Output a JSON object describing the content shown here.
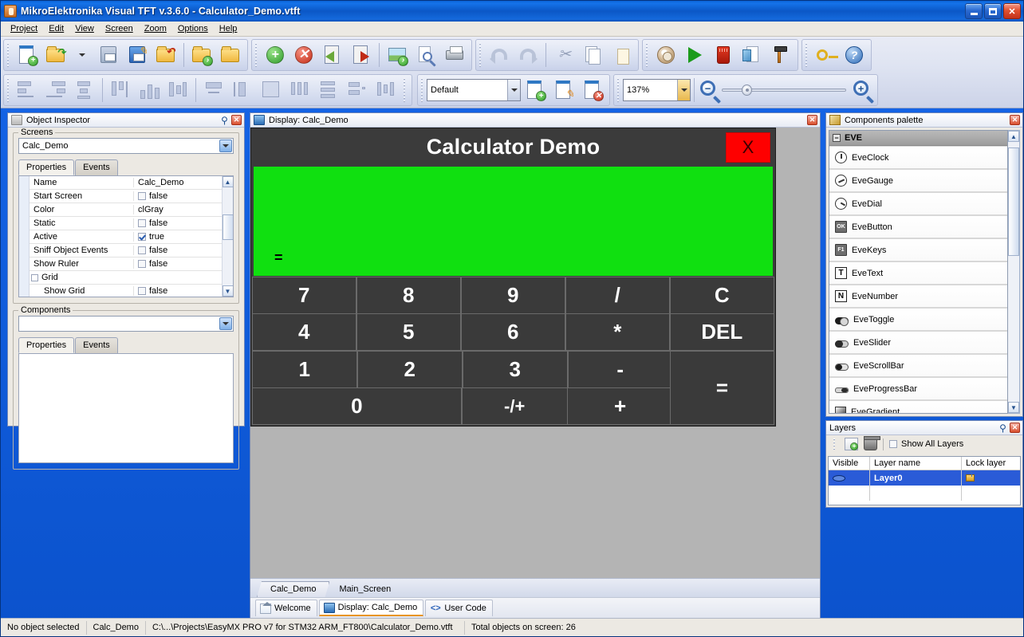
{
  "window": {
    "title": "MikroElektronika Visual TFT v.3.6.0 - Calculator_Demo.vtft",
    "icon": "app-icon",
    "minimize_label": "_",
    "maximize_label": "□",
    "close_label": "✕"
  },
  "menu": [
    {
      "label": "Project"
    },
    {
      "label": "Edit"
    },
    {
      "label": "View"
    },
    {
      "label": "Screen"
    },
    {
      "label": "Zoom"
    },
    {
      "label": "Options"
    },
    {
      "label": "Help"
    }
  ],
  "toolbar": {
    "groups": [
      {
        "name": "file",
        "buttons": [
          {
            "icon": "new-project-icon",
            "label": "New"
          },
          {
            "icon": "open-project-icon",
            "label": "Open"
          },
          {
            "icon": "save-icon",
            "label": "Save"
          },
          {
            "icon": "save-as-icon",
            "label": "Save As"
          },
          {
            "icon": "close-project-icon",
            "label": "Close Project"
          },
          {
            "icon": "open-examples-icon",
            "label": "Examples"
          },
          {
            "icon": "open-folder-icon",
            "label": "Open Folder"
          }
        ]
      },
      {
        "name": "screen",
        "buttons": [
          {
            "icon": "add-screen-icon",
            "label": "Add Screen"
          },
          {
            "icon": "delete-screen-icon",
            "label": "Delete Screen"
          },
          {
            "icon": "previous-screen-icon",
            "label": "Previous Screen"
          },
          {
            "icon": "next-screen-icon",
            "label": "Next Screen"
          },
          {
            "icon": "image-export-icon",
            "label": "Export Image"
          },
          {
            "icon": "preview-icon",
            "label": "Preview"
          },
          {
            "icon": "print-icon",
            "label": "Print"
          }
        ]
      },
      {
        "name": "edit",
        "buttons": [
          {
            "icon": "undo-icon",
            "label": "Undo"
          },
          {
            "icon": "redo-icon",
            "label": "Redo"
          },
          {
            "icon": "cut-icon",
            "label": "Cut"
          },
          {
            "icon": "copy-icon",
            "label": "Copy"
          },
          {
            "icon": "paste-icon",
            "label": "Paste"
          }
        ]
      },
      {
        "name": "build",
        "buttons": [
          {
            "icon": "generate-code-icon",
            "label": "Generate Code"
          },
          {
            "icon": "run-icon",
            "label": "Run"
          },
          {
            "icon": "memory-card-icon",
            "label": "Memory Card"
          },
          {
            "icon": "report-icon",
            "label": "Report"
          },
          {
            "icon": "tools-icon",
            "label": "Tools"
          }
        ]
      },
      {
        "name": "misc",
        "buttons": [
          {
            "icon": "license-key-icon",
            "label": "License"
          },
          {
            "icon": "help-icon",
            "label": "Help"
          }
        ]
      }
    ],
    "align_buttons": [
      {
        "icon": "align-left-icon",
        "label": "Align Left"
      },
      {
        "icon": "align-right-icon",
        "label": "Align Right"
      },
      {
        "icon": "align-center-horizontal-icon",
        "label": "Align Center Horizontal"
      },
      {
        "icon": "align-top-icon",
        "label": "Align Top"
      },
      {
        "icon": "align-bottom-icon",
        "label": "Align Bottom"
      },
      {
        "icon": "align-center-vertical-icon",
        "label": "Align Center Vertical"
      },
      {
        "icon": "size-width-icon",
        "label": "Equal Width"
      },
      {
        "icon": "size-height-icon",
        "label": "Equal Height"
      },
      {
        "icon": "size-both-icon",
        "label": "Equal Size"
      },
      {
        "icon": "space-horizontal-icon",
        "label": "Space Horizontally"
      },
      {
        "icon": "space-vertical-icon",
        "label": "Space Vertically"
      },
      {
        "icon": "distribute-icon",
        "label": "Distribute"
      },
      {
        "icon": "center-in-window-icon",
        "label": "Center In Window"
      }
    ],
    "font_combo": {
      "value": "Default",
      "placeholder": ""
    },
    "font_buttons": [
      {
        "icon": "add-font-icon",
        "label": "Add Font"
      },
      {
        "icon": "edit-font-icon",
        "label": "Edit Font"
      },
      {
        "icon": "delete-font-icon",
        "label": "Delete Font"
      }
    ],
    "zoom_combo": {
      "value": "137%"
    },
    "zoom_out_label": "−",
    "zoom_in_label": "+",
    "zoom_slider_position": "16"
  },
  "object_inspector": {
    "title": "Object Inspector",
    "pin_label": "⚲",
    "close_label": "✕",
    "screens_group_label": "Screens",
    "screens_value": "Calc_Demo",
    "tabs": [
      {
        "label": "Properties",
        "active": true
      },
      {
        "label": "Events",
        "active": false
      }
    ],
    "properties": [
      {
        "name": "Name",
        "value": "Calc_Demo",
        "type": "text"
      },
      {
        "name": "Start Screen",
        "value": "false",
        "type": "check",
        "checked": false
      },
      {
        "name": "Color",
        "value": "clGray",
        "type": "text"
      },
      {
        "name": "Static",
        "value": "false",
        "type": "check",
        "checked": false
      },
      {
        "name": "Active",
        "value": "true",
        "type": "check",
        "checked": true
      },
      {
        "name": "Sniff Object Events",
        "value": "false",
        "type": "check",
        "checked": false
      },
      {
        "name": "Show Ruler",
        "value": "false",
        "type": "check",
        "checked": false
      },
      {
        "name": "Grid",
        "value": "",
        "type": "group"
      },
      {
        "name": "Show Grid",
        "value": "false",
        "type": "check",
        "checked": false,
        "indent": true
      }
    ],
    "components_group_label": "Components",
    "components_value": "",
    "components_tabs": [
      {
        "label": "Properties",
        "active": true
      },
      {
        "label": "Events",
        "active": false
      }
    ]
  },
  "display_panel": {
    "title": "Display: Calc_Demo",
    "icon": "monitor-icon",
    "close_label": "✕",
    "calculator": {
      "title": "Calculator Demo",
      "close_label": "X",
      "screen_color": "#10e010",
      "screen_text": "=",
      "title_bar_color": "#3b3b3b",
      "close_button_color": "#fe0000",
      "keys": [
        [
          "7",
          "8",
          "9",
          "/",
          "C"
        ],
        [
          "4",
          "5",
          "6",
          "*",
          "DEL"
        ],
        [
          "1",
          "2",
          "3",
          "-"
        ],
        [
          "0",
          "-/+",
          "+"
        ]
      ],
      "tall_key": "="
    },
    "screen_tabs": [
      {
        "label": "Calc_Demo",
        "active": true
      },
      {
        "label": "Main_Screen",
        "active": false
      }
    ],
    "doc_tabs": [
      {
        "label": "Welcome",
        "icon": "home-icon",
        "active": false
      },
      {
        "label": "Display: Calc_Demo",
        "icon": "monitor-icon",
        "active": true
      },
      {
        "label": "User Code",
        "icon": "code-icon",
        "active": false
      }
    ]
  },
  "palette": {
    "title": "Components palette",
    "icon": "palette-icon",
    "close_label": "✕",
    "group_label": "EVE",
    "group_expander": "−",
    "items": [
      {
        "label": "EveClock",
        "icon": "clock-icon"
      },
      {
        "label": "EveGauge",
        "icon": "gauge-icon"
      },
      {
        "label": "EveDial",
        "icon": "dial-icon"
      },
      {
        "label": "EveButton",
        "icon": "button-icon",
        "glyph": "OK"
      },
      {
        "label": "EveKeys",
        "icon": "keys-icon",
        "glyph": "F1"
      },
      {
        "label": "EveText",
        "icon": "text-icon",
        "glyph": "T"
      },
      {
        "label": "EveNumber",
        "icon": "number-icon",
        "glyph": "N"
      },
      {
        "label": "EveToggle",
        "icon": "toggle-icon"
      },
      {
        "label": "EveSlider",
        "icon": "slider-icon"
      },
      {
        "label": "EveScrollBar",
        "icon": "scrollbar-icon"
      },
      {
        "label": "EveProgressBar",
        "icon": "progressbar-icon"
      },
      {
        "label": "EveGradient",
        "icon": "gradient-icon"
      }
    ]
  },
  "layers": {
    "title": "Layers",
    "pin_label": "⚲",
    "close_label": "✕",
    "new_layer_icon": "new-layer-icon",
    "delete_layer_icon": "delete-layer-icon",
    "show_all_label": "Show All Layers",
    "show_all_checked": false,
    "columns": [
      "Visible",
      "Layer name",
      "Lock layer"
    ],
    "rows": [
      {
        "name": "Layer0",
        "visible": true,
        "locked": true,
        "selected": true
      }
    ]
  },
  "statusbar": {
    "selection": "No object selected",
    "screen": "Calc_Demo",
    "path": "C:\\...\\Projects\\EasyMX PRO v7 for STM32 ARM_FT800\\Calculator_Demo.vtft",
    "objects": "Total objects on screen: 26"
  }
}
